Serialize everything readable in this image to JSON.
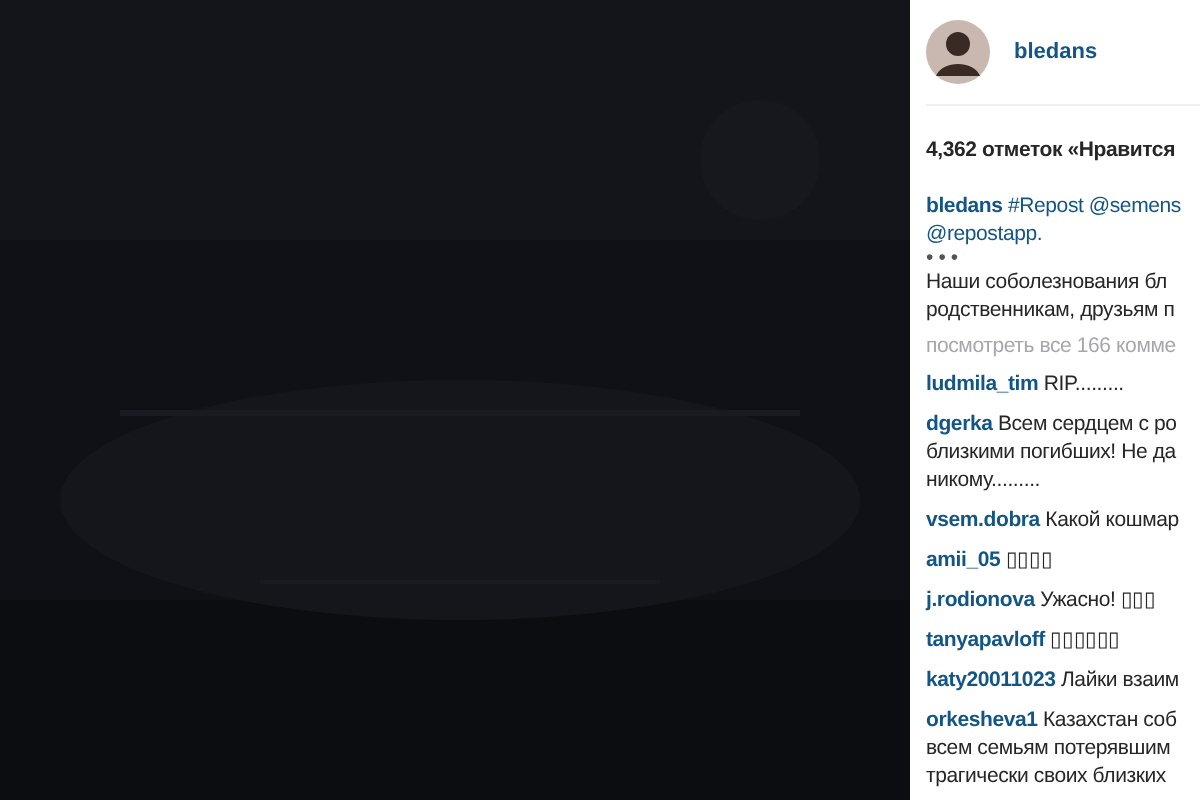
{
  "header": {
    "username": "bledans"
  },
  "likes": "4,362 отметок «Нравится",
  "caption": {
    "user": "bledans",
    "lines": [
      "#Repost @semens",
      "@repostapp."
    ],
    "more": "• • •",
    "body": [
      "Наши соболезнования бл",
      "родственникам, друзьям п"
    ]
  },
  "view_all": "посмотреть все 166 комме",
  "comments": [
    {
      "user": "ludmila_tim",
      "lines": [
        "RIP........."
      ]
    },
    {
      "user": "dgerka",
      "lines": [
        "Всем сердцем с ро",
        "близкими погибших! Не да",
        "никому........."
      ]
    },
    {
      "user": "vsem.dobra",
      "lines": [
        "Какой кошмар"
      ]
    },
    {
      "user": "amii_05",
      "lines": [
        "▯▯▯▯"
      ]
    },
    {
      "user": "j.rodionova",
      "lines": [
        "Ужасно! ▯▯▯"
      ]
    },
    {
      "user": "tanyapavloff",
      "lines": [
        "▯▯▯▯▯▯"
      ]
    },
    {
      "user": "katy20011023",
      "lines": [
        "Лайки взаим"
      ]
    },
    {
      "user": "orkesheva1",
      "lines": [
        "Казахстан соб",
        "всем семьям потерявшим",
        "трагически своих близких"
      ]
    }
  ]
}
